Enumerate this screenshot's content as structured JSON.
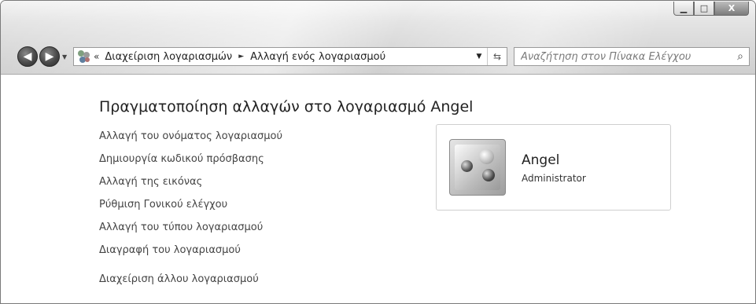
{
  "window": {
    "minimize_glyph": "▁",
    "maximize_glyph": "□",
    "close_glyph": "X"
  },
  "nav": {
    "back_icon": "back-arrow-icon",
    "forward_icon": "forward-arrow-icon",
    "back_glyph": "◀",
    "forward_glyph": "▶",
    "recent_glyph": "▼",
    "chevron": "«",
    "breadcrumb": [
      "Διαχείριση λογαριασμών",
      "Αλλαγή ενός λογαριασμού"
    ],
    "separator_glyph": "►",
    "dropdown_glyph": "▼",
    "refresh_glyph": "⇆"
  },
  "search": {
    "placeholder": "Αναζήτηση στον Πίνακα Ελέγχου",
    "icon_glyph": "⌕"
  },
  "main": {
    "title": "Πραγματοποίηση αλλαγών στο λογαριασμό Angel",
    "tasks": [
      "Αλλαγή του ονόματος λογαριασμού",
      "Δημιουργία κωδικού πρόσβασης",
      "Αλλαγή της εικόνας",
      "Ρύθμιση Γονικού ελέγχου",
      "Αλλαγή του τύπου λογαριασμού",
      "Διαγραφή του λογαριασμού"
    ],
    "other_task": "Διαχείριση άλλου λογαριασμού"
  },
  "account": {
    "name": "Angel",
    "role": "Administrator"
  }
}
